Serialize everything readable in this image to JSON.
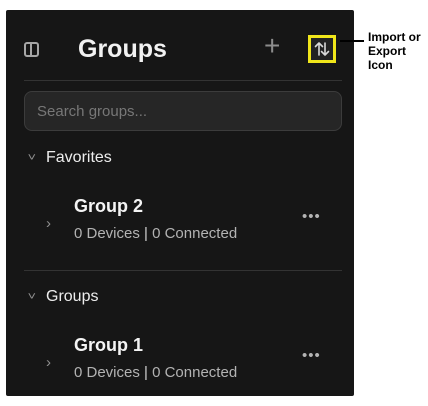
{
  "header": {
    "title": "Groups",
    "add_icon": "plus-icon",
    "import_export_icon": "arrows-up-down-icon",
    "sidebar_icon": "sidebar-toggle-icon"
  },
  "search": {
    "placeholder": "Search groups..."
  },
  "sections": [
    {
      "label": "Favorites",
      "groups": [
        {
          "name": "Group 2",
          "devices": "0 Devices",
          "connected": "0 Connected"
        }
      ]
    },
    {
      "label": "Groups",
      "groups": [
        {
          "name": "Group 1",
          "devices": "0 Devices",
          "connected": "0 Connected"
        }
      ]
    }
  ],
  "more_label": "•••",
  "callout": {
    "text": "Import or\nExport\nIcon"
  },
  "colors": {
    "panel_bg": "#161616",
    "highlight": "#f0e61a",
    "search_bg": "#262626"
  }
}
